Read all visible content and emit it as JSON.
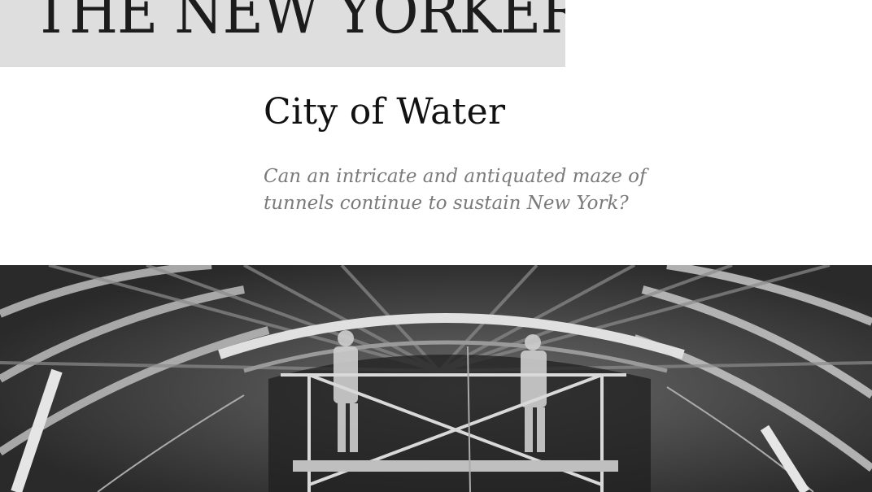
{
  "masthead": {
    "logo_text": "THE NEW YORKER"
  },
  "article": {
    "headline": "City of Water",
    "dek": "Can an intricate and antiquated maze of tunnels continue to sustain New York?"
  },
  "hero_image": {
    "description_icon": "tunnel-photo-icon"
  }
}
